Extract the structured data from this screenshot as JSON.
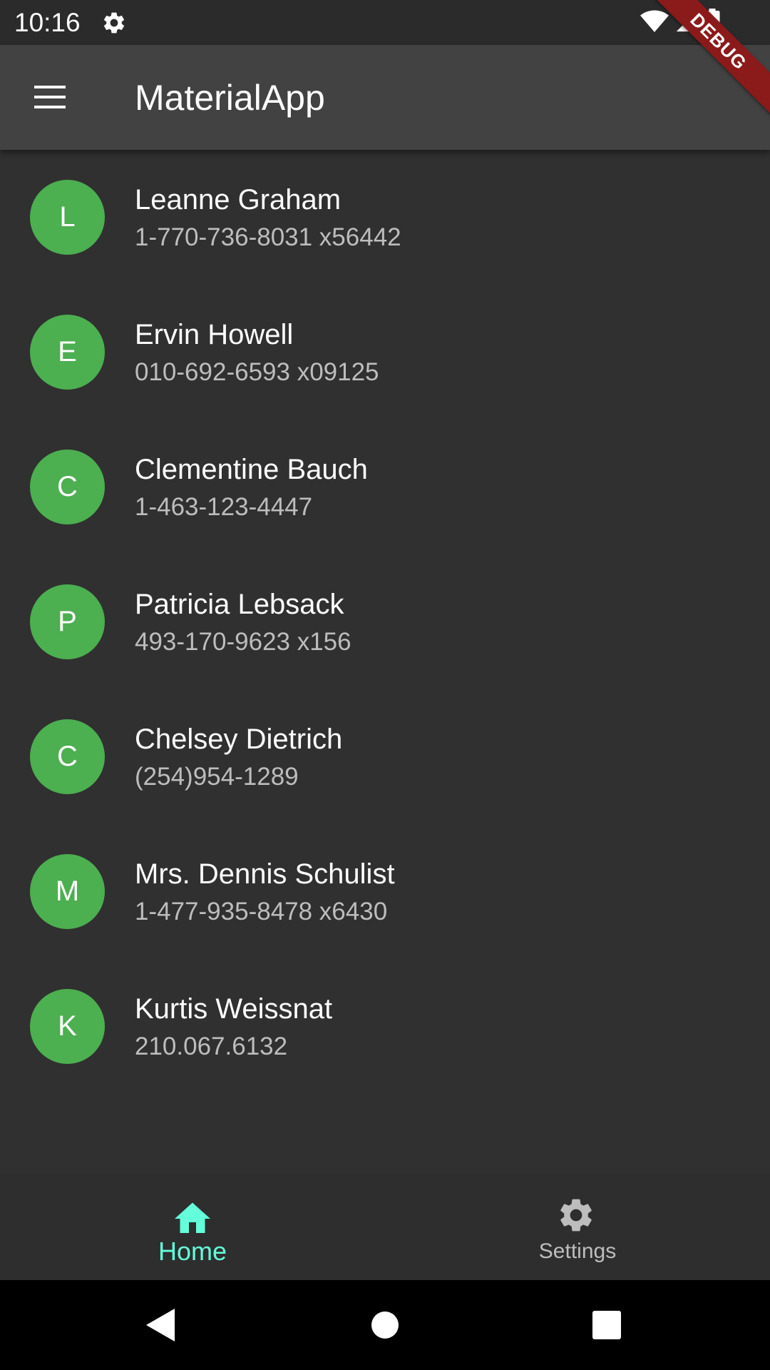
{
  "status_bar": {
    "time": "10:16"
  },
  "app_bar": {
    "title": "MaterialApp"
  },
  "debug_banner": {
    "label": "DEBUG"
  },
  "contacts": [
    {
      "initial": "L",
      "name": "Leanne Graham",
      "phone": "1-770-736-8031 x56442"
    },
    {
      "initial": "E",
      "name": "Ervin Howell",
      "phone": "010-692-6593 x09125"
    },
    {
      "initial": "C",
      "name": "Clementine Bauch",
      "phone": "1-463-123-4447"
    },
    {
      "initial": "P",
      "name": "Patricia Lebsack",
      "phone": "493-170-9623 x156"
    },
    {
      "initial": "C",
      "name": "Chelsey Dietrich",
      "phone": "(254)954-1289"
    },
    {
      "initial": "M",
      "name": "Mrs. Dennis Schulist",
      "phone": "1-477-935-8478 x6430"
    },
    {
      "initial": "K",
      "name": "Kurtis Weissnat",
      "phone": "210.067.6132"
    }
  ],
  "bottom_nav": {
    "items": [
      {
        "label": "Home",
        "icon": "home-icon",
        "active": true
      },
      {
        "label": "Settings",
        "icon": "settings-icon",
        "active": false
      }
    ]
  },
  "colors": {
    "background": "#303030",
    "app_bar": "#424242",
    "avatar": "#4caf50",
    "active_tab": "#64ffda",
    "debug_banner": "#8b1a1a"
  }
}
